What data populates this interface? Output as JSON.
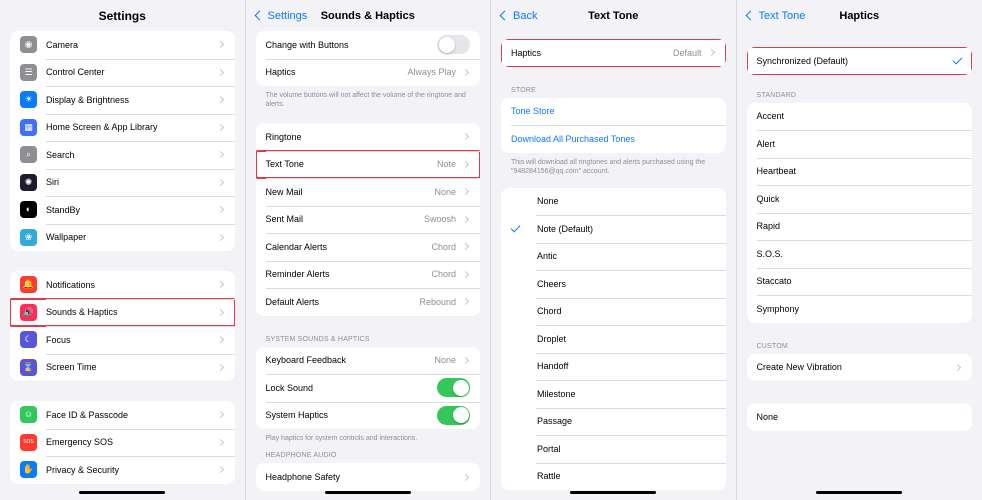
{
  "settings": {
    "title": "Settings",
    "group1": [
      {
        "label": "Camera",
        "icon": "camera-icon",
        "color": "#8e8e93",
        "glyph": "◉"
      },
      {
        "label": "Control Center",
        "icon": "control-center-icon",
        "color": "#8e8e93",
        "glyph": "☰"
      },
      {
        "label": "Display & Brightness",
        "icon": "sun-icon",
        "color": "#0a7aff",
        "glyph": "☀"
      },
      {
        "label": "Home Screen & App Library",
        "icon": "home-screen-icon",
        "color": "#3f6ffb",
        "glyph": "▦"
      },
      {
        "label": "Search",
        "icon": "search-icon",
        "color": "#8e8e93",
        "glyph": "⌕"
      },
      {
        "label": "Siri",
        "icon": "siri-icon",
        "color": "#1c1c2e",
        "glyph": "✺"
      },
      {
        "label": "StandBy",
        "icon": "standby-icon",
        "color": "#000000",
        "glyph": "◐"
      },
      {
        "label": "Wallpaper",
        "icon": "flower-icon",
        "color": "#33aadc",
        "glyph": "❀"
      }
    ],
    "group2": [
      {
        "label": "Notifications",
        "icon": "bell-icon",
        "color": "#ff3b30",
        "glyph": "🔔"
      },
      {
        "label": "Sounds & Haptics",
        "icon": "speaker-icon",
        "color": "#ff2d55",
        "glyph": "🔊"
      },
      {
        "label": "Focus",
        "icon": "moon-icon",
        "color": "#5856d6",
        "glyph": "☾"
      },
      {
        "label": "Screen Time",
        "icon": "hourglass-icon",
        "color": "#5856d6",
        "glyph": "⌛"
      }
    ],
    "group3": [
      {
        "label": "Face ID & Passcode",
        "icon": "face-id-icon",
        "color": "#34c759",
        "glyph": "☺"
      },
      {
        "label": "Emergency SOS",
        "icon": "sos-icon",
        "color": "#ff3b30",
        "glyph": "SOS"
      },
      {
        "label": "Privacy & Security",
        "icon": "hand-icon",
        "color": "#0a7aff",
        "glyph": "✋"
      }
    ]
  },
  "sounds": {
    "back": "Settings",
    "title": "Sounds & Haptics",
    "top": {
      "change_with_buttons": "Change with Buttons",
      "haptics": "Haptics",
      "haptics_value": "Always Play"
    },
    "top_note": "The volume buttons will not affect the volume of the ringtone and alerts.",
    "tones": [
      {
        "label": "Ringtone",
        "value": ""
      },
      {
        "label": "Text Tone",
        "value": "Note"
      },
      {
        "label": "New Mail",
        "value": "None"
      },
      {
        "label": "Sent Mail",
        "value": "Swoosh"
      },
      {
        "label": "Calendar Alerts",
        "value": "Chord"
      },
      {
        "label": "Reminder Alerts",
        "value": "Chord"
      },
      {
        "label": "Default Alerts",
        "value": "Rebound"
      }
    ],
    "system_header": "SYSTEM SOUNDS & HAPTICS",
    "system": {
      "keyboard_feedback": "Keyboard Feedback",
      "keyboard_value": "None",
      "lock_sound": "Lock Sound",
      "system_haptics": "System Haptics"
    },
    "system_note": "Play haptics for system controls and interactions.",
    "headphone_header": "HEADPHONE AUDIO",
    "headphone_safety": "Headphone Safety"
  },
  "text_tone": {
    "back": "Back",
    "title": "Text Tone",
    "haptics": "Haptics",
    "haptics_value": "Default",
    "store_header": "STORE",
    "tone_store": "Tone Store",
    "download_all": "Download All Purchased Tones",
    "store_note": "This will download all ringtones and alerts purchased using the \"948284156@qq.com\" account.",
    "tones": [
      "None",
      "Note (Default)",
      "Antic",
      "Cheers",
      "Chord",
      "Droplet",
      "Handoff",
      "Milestone",
      "Passage",
      "Portal",
      "Rattle"
    ],
    "selected": "Note (Default)"
  },
  "haptics": {
    "back": "Text Tone",
    "title": "Haptics",
    "synchronized": "Synchronized (Default)",
    "standard_header": "STANDARD",
    "standard": [
      "Accent",
      "Alert",
      "Heartbeat",
      "Quick",
      "Rapid",
      "S.O.S.",
      "Staccato",
      "Symphony"
    ],
    "custom_header": "CUSTOM",
    "create_new": "Create New Vibration",
    "none": "None"
  }
}
